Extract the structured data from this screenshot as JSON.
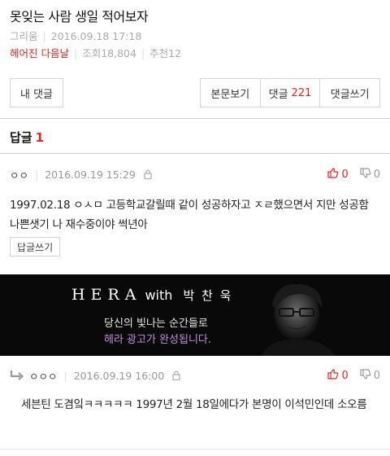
{
  "post": {
    "title": "못잊는 사람 생일 적어보자",
    "author": "그리움",
    "date": "2016.09.18 17:18",
    "category": "헤어진 다음날",
    "views": "조회18,804",
    "recommends": "추천12"
  },
  "buttons": {
    "my_comments": "내 댓글",
    "view_post": "본문보기",
    "comments": "댓글",
    "comment_count": "221",
    "write_comment": "댓글쓰기"
  },
  "reply_header": {
    "label": "답글",
    "count": "1"
  },
  "comments": [
    {
      "nick": "ㅇㅇ",
      "date": "2016.09.19 15:29",
      "likes": "0",
      "dislikes": "0",
      "text": "1997.02.18 ㅇㅅㅁ 고등학교갈릴때 같이 성공하자고 ㅈㄹ했으면서 지만 성공함 나쁜샛기 나 재수중이야 썩년아",
      "reply_label": "답글쓰기"
    },
    {
      "nick": "ㅇㅇㅇ",
      "date": "2016.09.19 16:00",
      "likes": "0",
      "dislikes": "0",
      "text": "세븐틴 도겸잌ㅋㅋㅋㅋㅋ 1997년 2월 18일에다가 본명이 이석민인데 소오름"
    }
  ],
  "ad": {
    "brand": "HERA",
    "with": "with",
    "person": "박 찬 욱",
    "line1": "당신의 빛나는 순간들로",
    "line2": "헤라 광고가 완성됩니다."
  },
  "colors": {
    "accent": "#e8231e",
    "ad_purple": "#c48fdb"
  },
  "icons": [
    "lock-icon",
    "thumbs-up-icon",
    "thumbs-down-icon",
    "reply-arrow-icon"
  ]
}
